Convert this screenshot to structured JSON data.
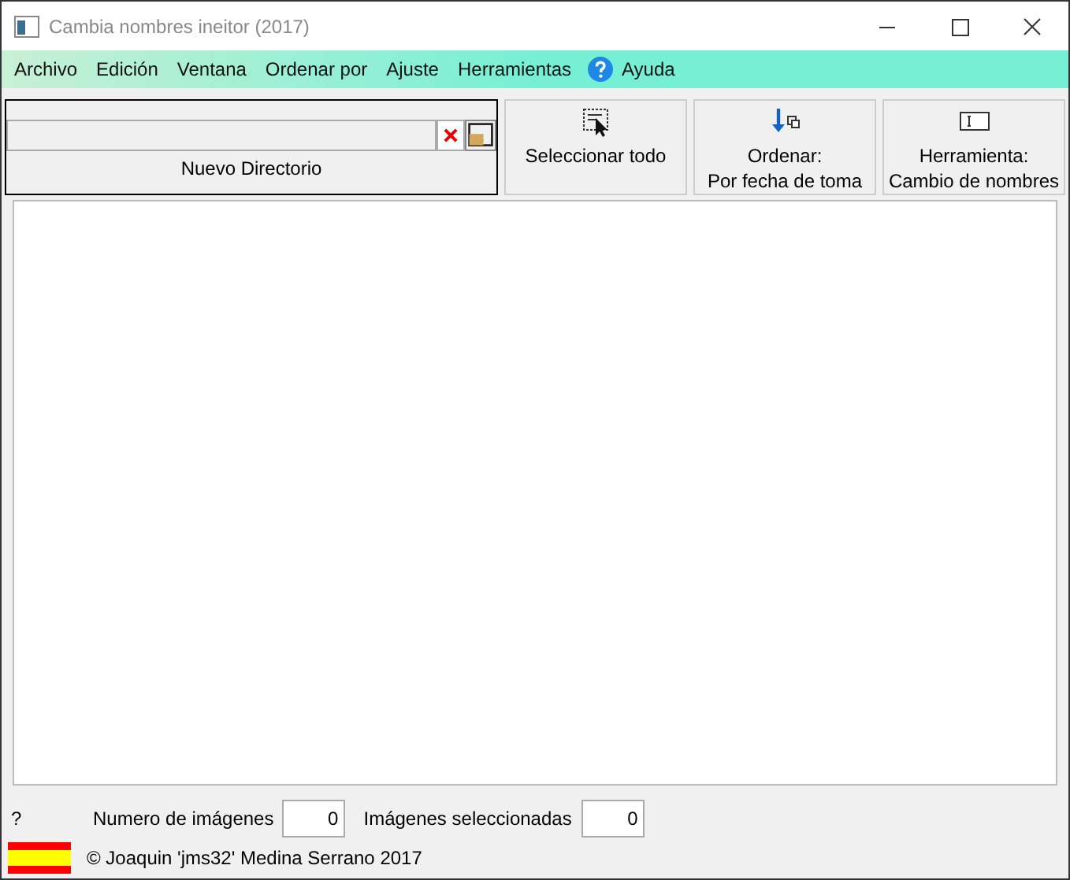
{
  "window": {
    "title": "Cambia nombres ineitor (2017)"
  },
  "menu": [
    {
      "label": "Archivo"
    },
    {
      "label": "Edición"
    },
    {
      "label": "Ventana"
    },
    {
      "label": "Ordenar por"
    },
    {
      "label": "Ajuste"
    },
    {
      "label": "Herramientas"
    },
    {
      "label": "Ayuda",
      "kind": "help"
    }
  ],
  "directory": {
    "label": "Nuevo Directorio"
  },
  "toolbar": [
    {
      "kind": "select",
      "lines": [
        "Seleccionar todo"
      ]
    },
    {
      "kind": "sort",
      "lines": [
        "Ordenar:",
        "Por fecha de toma"
      ]
    },
    {
      "kind": "tool",
      "lines": [
        "Herramienta:",
        "Cambio de nombres"
      ]
    }
  ],
  "status": {
    "help": "?",
    "count_label": "Numero de imágenes",
    "count": "0",
    "selected_label": "Imágenes seleccionadas",
    "selected": "0",
    "copyright": "© Joaquin 'jms32' Medina Serrano 2017"
  }
}
